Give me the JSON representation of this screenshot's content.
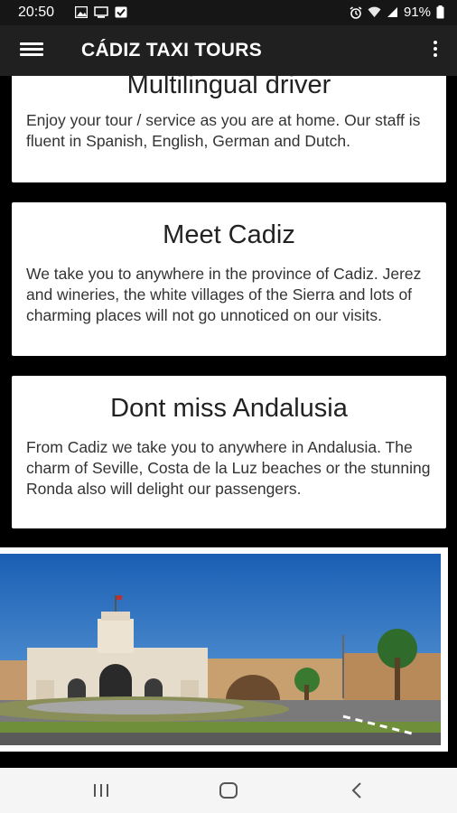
{
  "status_bar": {
    "time": "20:50",
    "battery": "91%",
    "icons": [
      "gallery-icon",
      "monitor-icon",
      "checkbox-icon",
      "alarm-icon",
      "wifi-icon",
      "signal-icon",
      "battery-icon"
    ]
  },
  "toolbar": {
    "title": "CÁDIZ TAXI TOURS",
    "menu_icon": "hamburger-menu-icon",
    "overflow_icon": "more-vert-icon"
  },
  "cards": [
    {
      "title": "Multilingual driver",
      "text": "Enjoy your tour / service as you are at home. Our staff is fluent in Spanish, English, German and Dutch."
    },
    {
      "title": "Meet Cadiz",
      "text": "We take you to anywhere in the province of Cadiz. Jerez and wineries, the white villages of the Sierra and lots of charming places will not go unnoticed on our visits."
    },
    {
      "title": "Dont miss Andalusia",
      "text": "From Cadiz we take you to anywhere in Andalusia. The charm of Seville, Costa de la Luz beaches or the stunning Ronda also will delight our passengers."
    }
  ],
  "photo": {
    "subject": "puerta-de-tierra-gate"
  },
  "nav_bar": {
    "icons": [
      "recents-icon",
      "home-icon",
      "back-icon"
    ]
  },
  "colors": {
    "toolbar": "#202020",
    "status_bar": "#161616",
    "background": "#000000",
    "card": "#ffffff"
  }
}
